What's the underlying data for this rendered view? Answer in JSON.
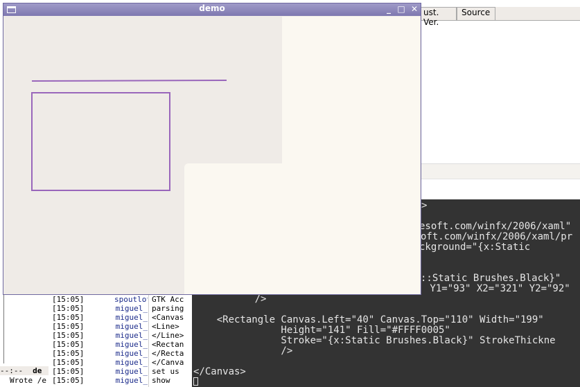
{
  "background_app": {
    "tabs": [
      {
        "label": "ust. Ver."
      },
      {
        "label": "Source"
      }
    ]
  },
  "terminal": {
    "lines": [
      ">",
      "esoft.com/winfx/2006/xaml\"",
      "oft.com/winfx/2006/xaml/pr",
      "ckground=\"{x:Static",
      "",
      "::Static Brushes.Black}\"",
      " Y1=\"93\" X2=\"321\" Y2=\"92\"",
      "      />",
      "",
      "    <Rectangle Canvas.Left=\"40\" Canvas.Top=\"110\" Width=\"199\"",
      "               Height=\"141\" Fill=\"#FFFF0005\"",
      "               Stroke=\"{x:Static Brushes.Black}\" StrokeThickne",
      "               />",
      "",
      "</Canvas>"
    ]
  },
  "irc": {
    "rows": [
      {
        "time": "[15:05]",
        "nick": "spoutlot",
        "msg": "GTK Acc"
      },
      {
        "time": "[15:05]",
        "nick": "miguel_",
        "msg": "parsing"
      },
      {
        "time": "[15:05]",
        "nick": "miguel_",
        "msg": "<Canvas"
      },
      {
        "time": "[15:05]",
        "nick": "miguel_",
        "msg": "<Line>"
      },
      {
        "time": "[15:05]",
        "nick": "miguel_",
        "msg": "</Line>"
      },
      {
        "time": "[15:05]",
        "nick": "miguel_",
        "msg": "<Rectan"
      },
      {
        "time": "[15:05]",
        "nick": "miguel_",
        "msg": "</Recta"
      },
      {
        "time": "[15:05]",
        "nick": "miguel_",
        "msg": "</Canva"
      },
      {
        "time": "[15:05]",
        "nick": "miguel_",
        "msg": "set us"
      },
      {
        "time": "[15:05]",
        "nick": "miguel_",
        "msg": "show"
      }
    ]
  },
  "emacs": {
    "modeline_prefix": "--:--",
    "modeline_buffer": "de",
    "minibuffer": "Wrote /e"
  },
  "demo_window": {
    "title": "demo",
    "minimize_glyph": "_",
    "maximize_glyph": "□",
    "close_glyph": "✕",
    "stroke_color": "#9966bb"
  }
}
